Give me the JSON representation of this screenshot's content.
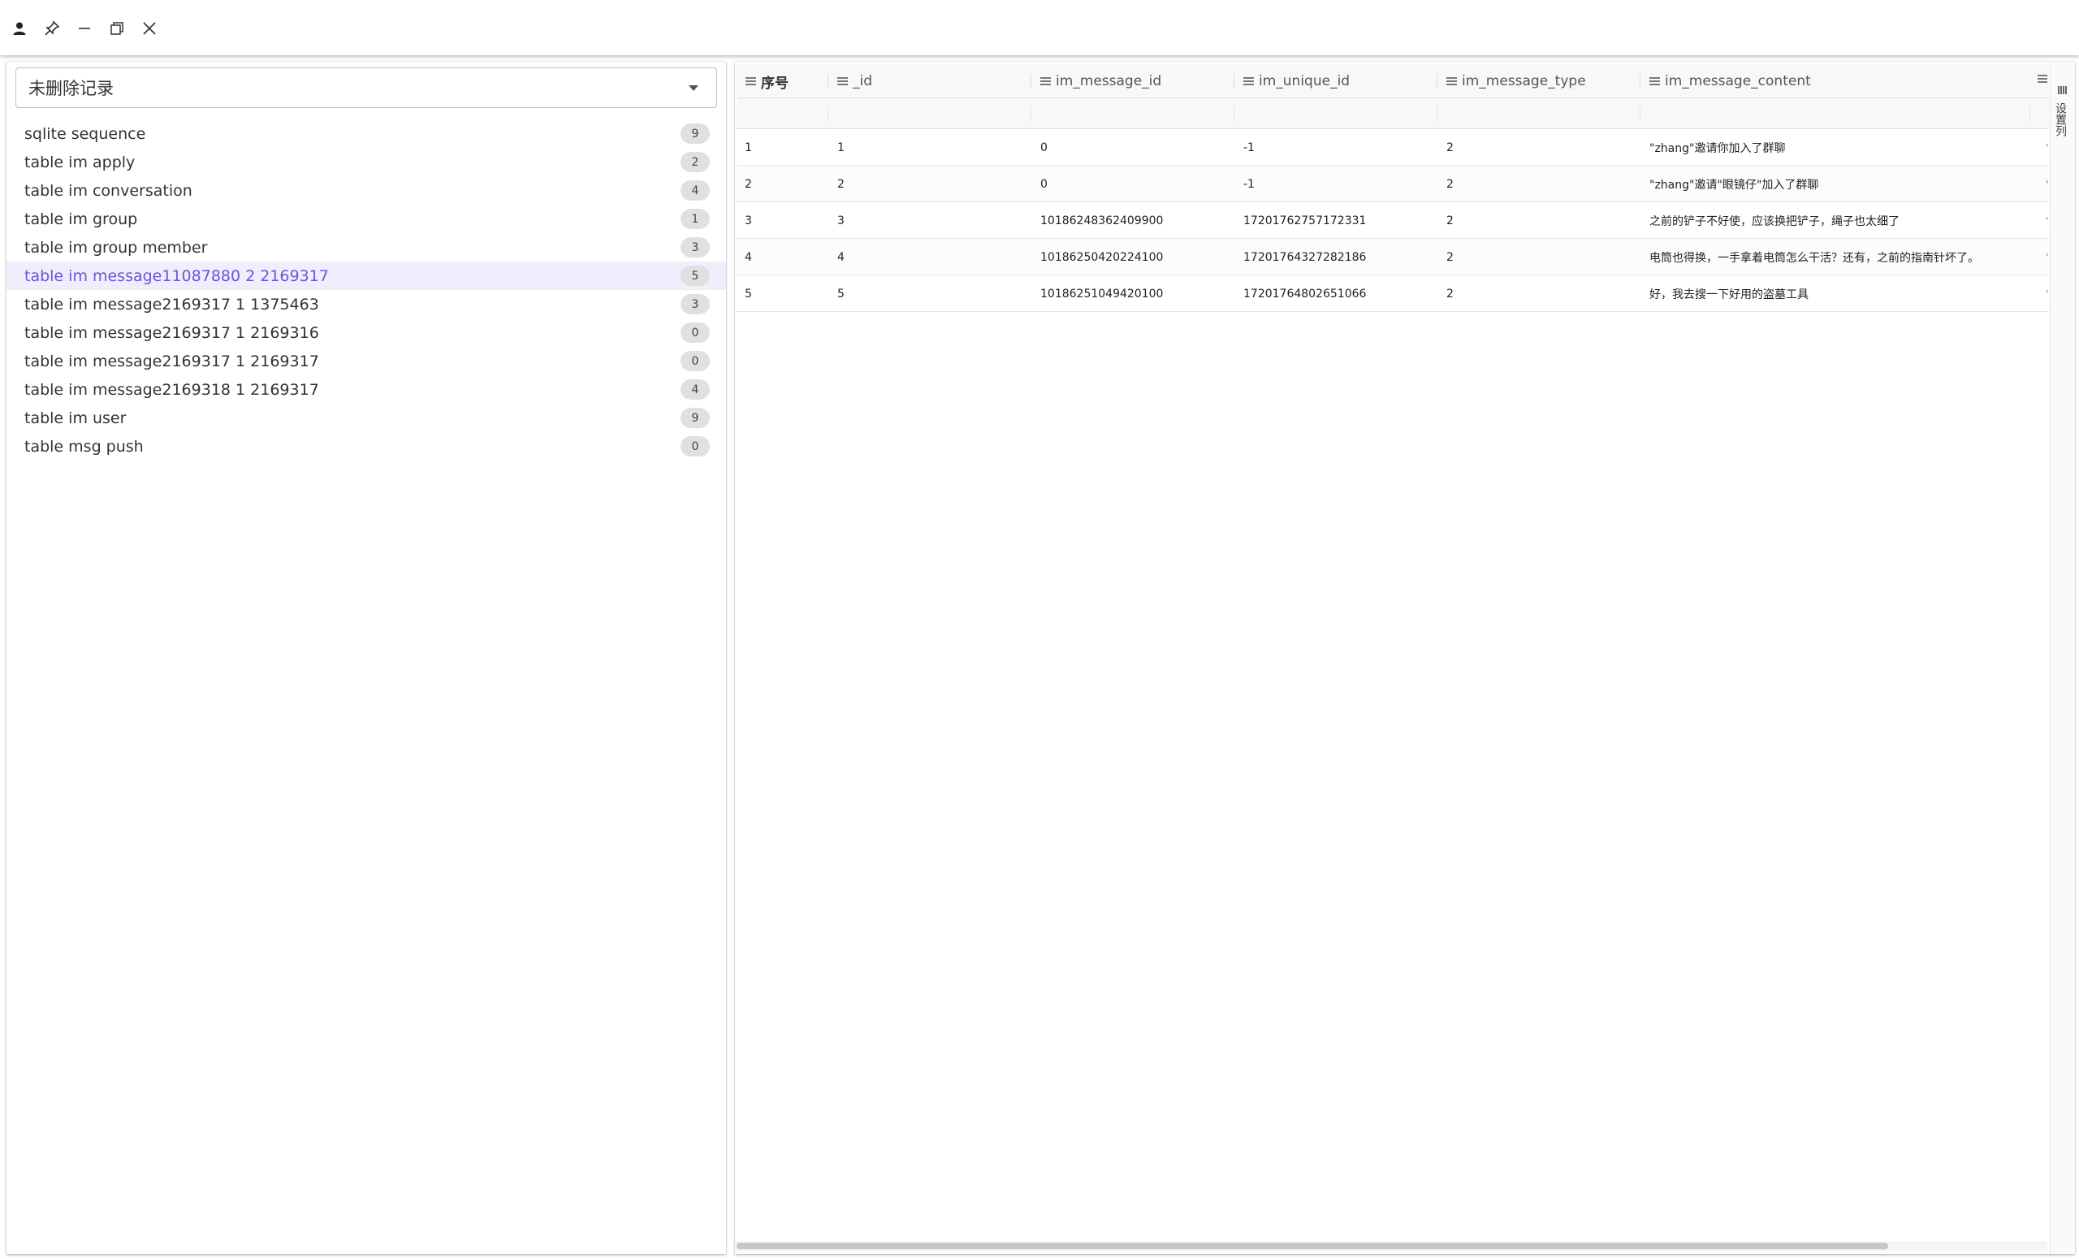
{
  "titlebar": {
    "icons": [
      "user-icon",
      "pin-icon",
      "minimize-icon",
      "restore-icon",
      "close-icon"
    ]
  },
  "filter_select": {
    "value": "未删除记录"
  },
  "tables": [
    {
      "name": "sqlite sequence",
      "count": "9"
    },
    {
      "name": "table im apply",
      "count": "2"
    },
    {
      "name": "table im conversation",
      "count": "4"
    },
    {
      "name": "table im group",
      "count": "1"
    },
    {
      "name": "table im group member",
      "count": "3"
    },
    {
      "name": "table im message11087880 2 2169317",
      "count": "5"
    },
    {
      "name": "table im message2169317 1 1375463",
      "count": "3"
    },
    {
      "name": "table im message2169317 1 2169316",
      "count": "0"
    },
    {
      "name": "table im message2169317 1 2169317",
      "count": "0"
    },
    {
      "name": "table im message2169318 1 2169317",
      "count": "4"
    },
    {
      "name": "table im user",
      "count": "9"
    },
    {
      "name": "table msg push",
      "count": "0"
    }
  ],
  "selected_table_index": 5,
  "grid": {
    "columns": [
      "序号",
      "_id",
      "im_message_id",
      "im_unique_id",
      "im_message_type",
      "im_message_content"
    ],
    "rows": [
      [
        "1",
        "1",
        "0",
        "-1",
        "2",
        "\"zhang\"邀请你加入了群聊"
      ],
      [
        "2",
        "2",
        "0",
        "-1",
        "2",
        "\"zhang\"邀请\"眼镜仔\"加入了群聊"
      ],
      [
        "3",
        "3",
        "101862483624099​00",
        "17201762757172331",
        "2",
        "之前的铲子不好使，应该换把铲子，绳子也太细了"
      ],
      [
        "4",
        "4",
        "10186250420224100",
        "17201764327282186",
        "2",
        "电筒也得换，一手拿着电筒怎么干活？还有，之前的指南针坏了。"
      ],
      [
        "5",
        "5",
        "10186251049420100",
        "17201764802651066",
        "2",
        "好，我去搜一下好用的盗墓工具"
      ]
    ]
  },
  "side_tool": {
    "label": "设置列"
  },
  "colors": {
    "accent": "#6a56d8",
    "selected_bg": "#efeefc",
    "badge_bg": "#e0e0e0"
  }
}
